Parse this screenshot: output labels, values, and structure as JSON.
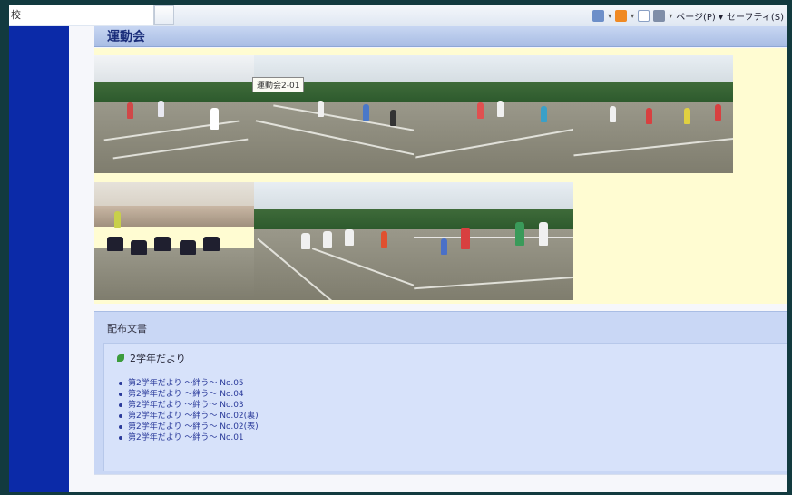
{
  "browser": {
    "address_fragment": "校",
    "page_menu": "ページ(P) ▾",
    "safety_menu": "セーフティ(S)"
  },
  "section": {
    "title": "運動会"
  },
  "gallery": {
    "tooltip": "運動会2-01"
  },
  "documents": {
    "heading": "配布文書",
    "category": "2学年だより",
    "items": [
      "第2学年だより ～絆う～ No.05",
      "第2学年だより ～絆う～ No.04",
      "第2学年だより ～絆う～ No.03",
      "第2学年だより ～絆う～ No.02(裏)",
      "第2学年だより ～絆う～ No.02(表)",
      "第2学年だより ～絆う～ No.01"
    ]
  },
  "colors": {
    "sidebar": "#0b2aa8",
    "gallery_bg": "#fffcd2",
    "docs_bg": "#c9d7f5",
    "section_head": "#a9bde4"
  }
}
